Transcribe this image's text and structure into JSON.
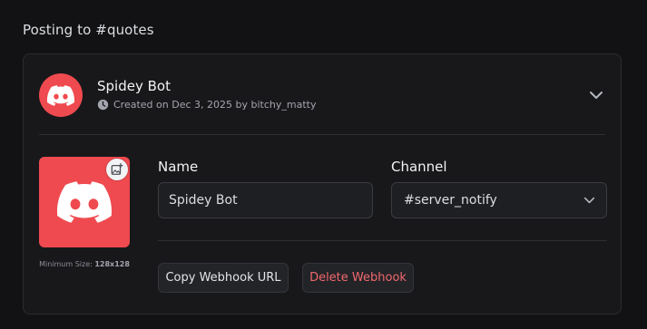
{
  "section": {
    "title": "Posting to #quotes"
  },
  "webhook": {
    "name": "Spidey Bot",
    "created_text": "Created on Dec 3, 2025 by bitchy_matty",
    "avatar_color": "#ef4a4f",
    "avatar_icon": "discord-logo-icon",
    "min_size_label": "Minimum Size:",
    "min_size_value": "128x128"
  },
  "form": {
    "name_label": "Name",
    "name_value": "Spidey Bot",
    "channel_label": "Channel",
    "channel_value": "#server_notify"
  },
  "actions": {
    "copy_label": "Copy Webhook URL",
    "delete_label": "Delete Webhook"
  },
  "colors": {
    "background": "#121214",
    "card": "#18181b",
    "danger_text": "#f0686c"
  }
}
